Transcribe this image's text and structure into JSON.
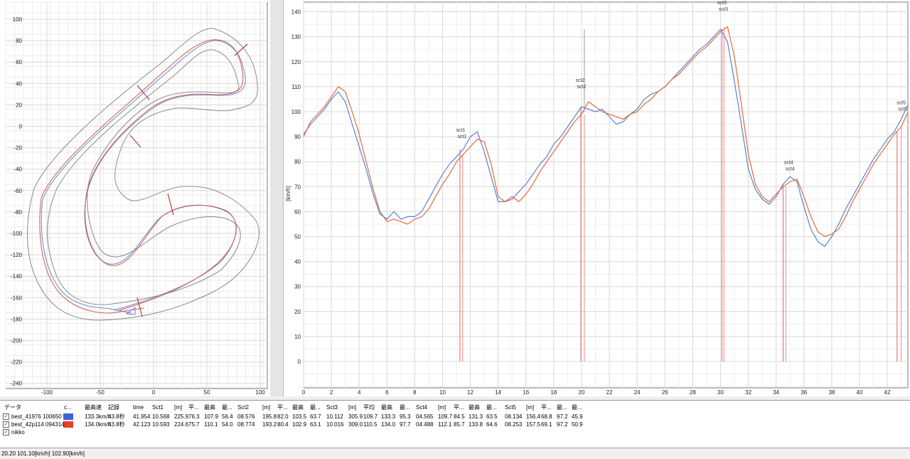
{
  "track_map": {
    "y_ticks": [
      "100",
      "80",
      "60",
      "40",
      "20",
      "0",
      "-20",
      "-40",
      "-60",
      "-80",
      "-100",
      "-120",
      "-140",
      "-160",
      "-180",
      "-200",
      "-220",
      "-240"
    ],
    "x_ticks": [
      "-100",
      "-50",
      "0",
      "50",
      "100"
    ]
  },
  "speed_chart": {
    "y_axis_label": "[km/h]",
    "y_ticks": [
      "0",
      "10",
      "20",
      "30",
      "40",
      "50",
      "60",
      "70",
      "80",
      "90",
      "100",
      "110",
      "120",
      "130",
      "140"
    ],
    "x_ticks": [
      "0",
      "2",
      "4",
      "6",
      "8",
      "10",
      "12",
      "14",
      "16",
      "18",
      "20",
      "22",
      "24",
      "26",
      "28",
      "30",
      "32",
      "34",
      "36",
      "38",
      "40",
      "42"
    ],
    "markers": [
      {
        "top": "sct1",
        "bottom": "sct1"
      },
      {
        "top": "sct2",
        "bottom": "sct2"
      },
      {
        "top": "sct3",
        "bottom": "sct3"
      },
      {
        "top": "sct4",
        "bottom": "sct4"
      },
      {
        "top": "sct5",
        "bottom": "sct5"
      }
    ]
  },
  "chart_data": {
    "type": "line",
    "xlim": [
      0,
      43.5
    ],
    "ylim": [
      -2,
      145
    ],
    "ylabel": "[km/h]",
    "grid": true,
    "series": [
      {
        "name": "best_41976 100650",
        "color": "#5b80d8",
        "x": [
          0,
          0.5,
          1,
          1.5,
          2,
          2.5,
          3,
          3.5,
          4,
          4.5,
          5,
          5.5,
          6,
          6.5,
          7,
          7.5,
          8,
          8.5,
          9,
          9.5,
          10,
          10.5,
          11,
          11.5,
          12,
          12.5,
          13,
          13.5,
          14,
          14.5,
          15,
          15.5,
          16,
          16.5,
          17,
          17.5,
          18,
          18.5,
          19,
          19.5,
          20,
          20.5,
          21,
          21.5,
          22,
          22.5,
          23,
          23.5,
          24,
          24.5,
          25,
          25.5,
          26,
          26.5,
          27,
          27.5,
          28,
          28.5,
          29,
          29.5,
          30,
          30.5,
          31,
          31.5,
          32,
          32.5,
          33,
          33.5,
          34,
          34.5,
          35,
          35.5,
          36,
          36.5,
          37,
          37.5,
          38,
          38.5,
          39,
          39.5,
          40,
          40.5,
          41,
          41.5,
          42,
          42.5,
          43,
          43.5
        ],
        "y": [
          91,
          95,
          98,
          101,
          105,
          108,
          104,
          95,
          86,
          77,
          67,
          59,
          57,
          60,
          57,
          58,
          58,
          60,
          65,
          70,
          75,
          79,
          82,
          85,
          90,
          92,
          84,
          74,
          64,
          64,
          65,
          68,
          71,
          75,
          79,
          82,
          87,
          90,
          94,
          98,
          102,
          101,
          100,
          101,
          98,
          95,
          96,
          99,
          101,
          105,
          107,
          108,
          110,
          113,
          116,
          119,
          122,
          125,
          127,
          130,
          133,
          128,
          112,
          95,
          77,
          69,
          65,
          63,
          66,
          71,
          74,
          72,
          62,
          53,
          48,
          46,
          50,
          55,
          61,
          66,
          71,
          76,
          81,
          85,
          89,
          92,
          97,
          103
        ]
      },
      {
        "name": "best_42p114 094314",
        "color": "#e36a3a",
        "x": [
          0,
          0.5,
          1,
          1.5,
          2,
          2.5,
          3,
          3.5,
          4,
          4.5,
          5,
          5.5,
          6,
          6.5,
          7,
          7.5,
          8,
          8.5,
          9,
          9.5,
          10,
          10.5,
          11,
          11.5,
          12,
          12.5,
          13,
          13.5,
          14,
          14.5,
          15,
          15.5,
          16,
          16.5,
          17,
          17.5,
          18,
          18.5,
          19,
          19.5,
          20,
          20.5,
          21,
          21.5,
          22,
          22.5,
          23,
          23.5,
          24,
          24.5,
          25,
          25.5,
          26,
          26.5,
          27,
          27.5,
          28,
          28.5,
          29,
          29.5,
          30,
          30.5,
          31,
          31.5,
          32,
          32.5,
          33,
          33.5,
          34,
          34.5,
          35,
          35.5,
          36,
          36.5,
          37,
          37.5,
          38,
          38.5,
          39,
          39.5,
          40,
          40.5,
          41,
          41.5,
          42,
          42.5,
          43,
          43.5
        ],
        "y": [
          90,
          96,
          99,
          102,
          106,
          110,
          108,
          100,
          91,
          80,
          69,
          60,
          56,
          57,
          56,
          55,
          57,
          58,
          61,
          66,
          71,
          75,
          80,
          83,
          86,
          89,
          88,
          79,
          66,
          64,
          66,
          64,
          67,
          71,
          76,
          80,
          84,
          88,
          92,
          96,
          99,
          104,
          102,
          100,
          99,
          98,
          97,
          99,
          100,
          103,
          105,
          108,
          110,
          113,
          115,
          118,
          121,
          124,
          126,
          129,
          132,
          134,
          122,
          103,
          83,
          71,
          66,
          64,
          67,
          70,
          72,
          73,
          66,
          58,
          52,
          50,
          51,
          53,
          58,
          64,
          69,
          74,
          79,
          83,
          87,
          91,
          94,
          100
        ]
      }
    ],
    "sectors": [
      {
        "label": "sct1",
        "x": [
          11.25,
          11.45
        ]
      },
      {
        "label": "sct2",
        "x": [
          19.95,
          20.2
        ]
      },
      {
        "label": "sct3",
        "x": [
          30.1,
          30.25
        ]
      },
      {
        "label": "sct4",
        "x": [
          34.5,
          34.7
        ]
      },
      {
        "label": "sct5",
        "x": [
          42.7,
          43.0
        ]
      }
    ]
  },
  "table": {
    "headers": [
      "データ",
      "c...",
      "最高速",
      "記録",
      "time",
      "Sct1",
      "[m]",
      "平...",
      "最高",
      "最...",
      "Sct2",
      "[m]",
      "平...",
      "最高",
      "最...",
      "Sct3",
      "[m]",
      "平均",
      "最高",
      "最...",
      "Sct4",
      "[m]",
      "平...",
      "最高",
      "最...",
      "Sct5",
      "[m]",
      "平...",
      "最...",
      "最..."
    ],
    "rows": [
      {
        "checked": "✓",
        "color": "#3f63d8",
        "cells": [
          "best_41976 100650",
          "",
          "133.3km/h",
          "43.8秒",
          "41.954",
          "10.568",
          "225.9",
          "76.3",
          "107.9",
          "56.4",
          "08.576",
          "195.8",
          "82.0",
          "103.5",
          "63.7",
          "10.112",
          "305.9",
          "109.7",
          "133.3",
          "95.3",
          "04.565",
          "109.7",
          "84.5",
          "131.3",
          "63.5",
          "08.134",
          "156.4",
          "68.8",
          "97.2",
          "45.9"
        ]
      },
      {
        "checked": "✓",
        "color": "#e8402a",
        "cells": [
          "best_42p114 094314",
          "",
          "134.0km/h",
          "43.8秒",
          "42.123",
          "10.593",
          "224.6",
          "75.7",
          "110.1",
          "54.0",
          "08.774",
          "193.2",
          "80.4",
          "102.9",
          "63.1",
          "10.016",
          "309.0",
          "110.5",
          "134.0",
          "97.7",
          "04.488",
          "112.1",
          "85.7",
          "133.8",
          "64.6",
          "08.253",
          "157.5",
          "69.1",
          "97.2",
          "50.9"
        ]
      },
      {
        "checked": "✓",
        "color": "",
        "cells": [
          "nikko"
        ]
      }
    ]
  },
  "status": {
    "text": "20.20  101.10[km/h]  102.90[km/h]"
  }
}
